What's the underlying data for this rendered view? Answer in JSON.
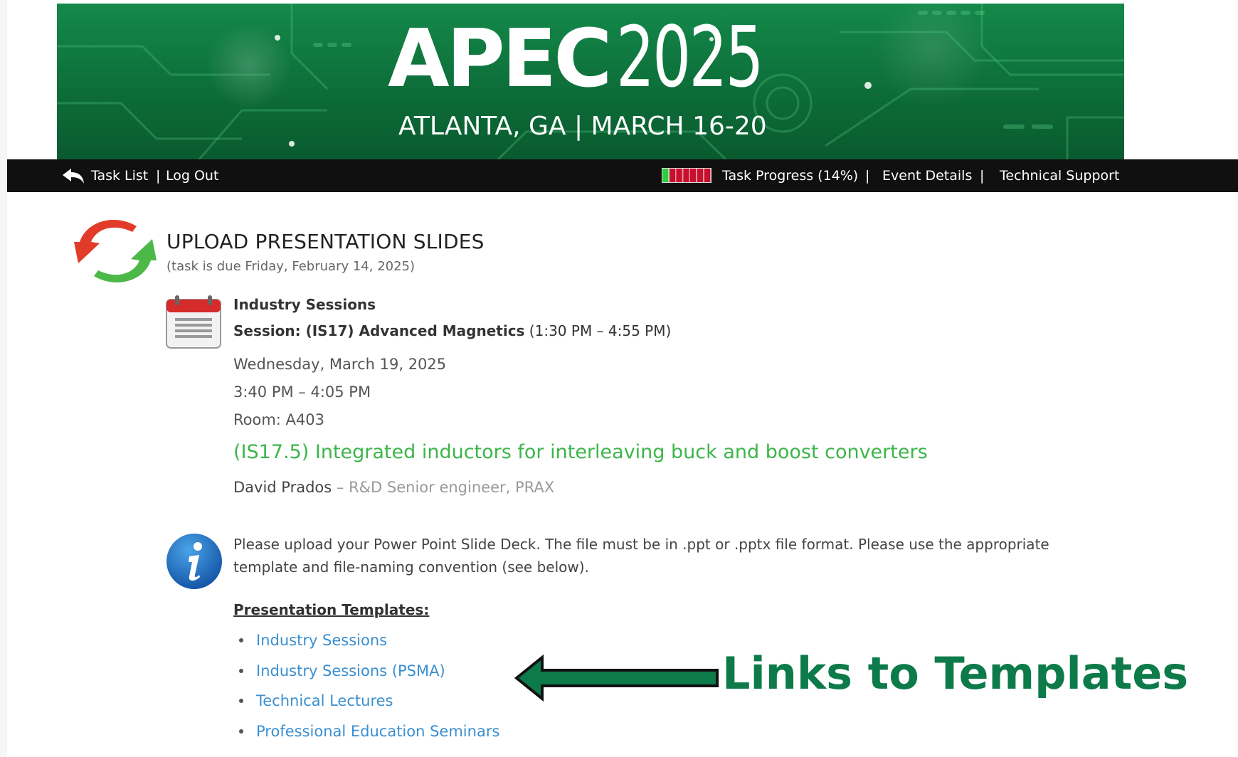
{
  "banner": {
    "logo_word": "APEC",
    "logo_year": "2025",
    "subtitle": "ATLANTA, GA | MARCH 16-20"
  },
  "nav": {
    "task_list": "Task List",
    "separator": "|",
    "log_out": "Log Out",
    "task_progress": "Task Progress (14%)",
    "task_progress_value": 0.14,
    "event_details": "Event Details",
    "technical_support": "Technical Support"
  },
  "task": {
    "title": "UPLOAD PRESENTATION SLIDES",
    "due": "(task is due Friday, February 14, 2025)"
  },
  "session": {
    "track": "Industry Sessions",
    "label": "Session: (IS17) Advanced Magnetics",
    "time_range": " (1:30 PM – 4:55 PM)",
    "date": "Wednesday, March 19, 2025",
    "slot": "3:40 PM – 4:05 PM",
    "room": "Room: A403",
    "paper_title": "(IS17.5) Integrated inductors for interleaving buck and boost converters",
    "author_name": "David Prados",
    "author_sep": " – ",
    "author_affiliation": "R&D Senior engineer, PRAX"
  },
  "info": {
    "text": "Please upload your Power Point Slide Deck. The file must be in .ppt or .pptx file format. Please use the appropriate template and file-naming convention (see below)."
  },
  "templates": {
    "heading": "Presentation Templates:",
    "items": [
      {
        "label": "Industry Sessions"
      },
      {
        "label": "Industry Sessions (PSMA)"
      },
      {
        "label": "Technical Lectures"
      },
      {
        "label": "Professional Education Seminars"
      }
    ]
  },
  "annotation": {
    "text": "Links to Templates",
    "color": "#0d7a4a"
  },
  "colors": {
    "banner_green": "#0d6e39",
    "paper_title_green": "#3db54a",
    "link_blue": "#3a8fd0",
    "navbar": "#101010",
    "progress_done": "#2ecc40",
    "progress_remaining": "#c8102e"
  }
}
